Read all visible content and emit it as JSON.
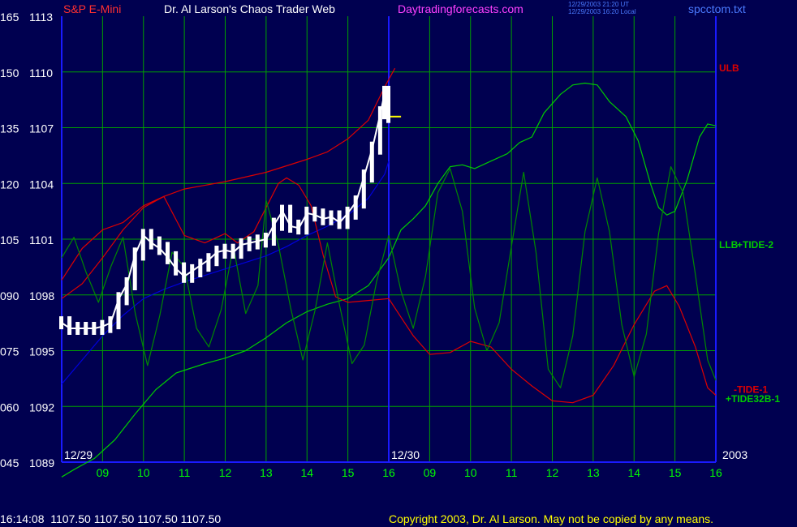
{
  "header": {
    "symbol": "S&P E-Mini",
    "author": "Dr. Al Larson's Chaos Trader Web",
    "site": "Daytradingforecasts.com",
    "stamp_utc": "12/29/2003 21:20 UT",
    "stamp_local": "12/29/2003 16:20 Local",
    "file": "spcctom.txt"
  },
  "footer": {
    "quote": "16:14:08  1107.50 1107.50 1107.50 1107.50",
    "copyright": "Copyright 2003, Dr. Al Larson. May not be copied by any means."
  },
  "colors": {
    "background": "#000050",
    "grid": "#00a000",
    "axis": "#1a1aff",
    "price": "#ffffff",
    "symbol": "#ff3030",
    "author": "#ffffff",
    "site": "#ff40ff",
    "stamp": "#4a7aff",
    "file": "#4a7aff",
    "tick_text": "#ffffff",
    "time_text": "#00ff00",
    "ulb": "#dd0000",
    "llb": "#0000dd",
    "tide2": "#00cc00",
    "tide1": "#dd0000",
    "tide32b": "#008800",
    "forecast": "#ffff00"
  },
  "chart_data": {
    "type": "line",
    "x_unit": "hour (x axis counts hours from 08:00 on 12/29 to 16:00 on 12/30)",
    "xlim": [
      8,
      24
    ],
    "ylim": [
      1089,
      1113
    ],
    "y_ticks": [
      {
        "value": 1113,
        "left": "165",
        "right": "1113"
      },
      {
        "value": 1110,
        "left": "150",
        "right": "1110"
      },
      {
        "value": 1107,
        "left": "135",
        "right": "1107"
      },
      {
        "value": 1104,
        "left": "120",
        "right": "1104"
      },
      {
        "value": 1101,
        "left": "105",
        "right": "1101"
      },
      {
        "value": 1098,
        "left": "090",
        "right": "1098"
      },
      {
        "value": 1095,
        "left": "075",
        "right": "1095"
      },
      {
        "value": 1092,
        "left": "060",
        "right": "1092"
      },
      {
        "value": 1089,
        "left": "045",
        "right": "1089"
      }
    ],
    "x_ticks": [
      {
        "x": 9,
        "label": "09"
      },
      {
        "x": 10,
        "label": "10"
      },
      {
        "x": 11,
        "label": "11"
      },
      {
        "x": 12,
        "label": "12"
      },
      {
        "x": 13,
        "label": "13"
      },
      {
        "x": 14,
        "label": "14"
      },
      {
        "x": 15,
        "label": "15"
      },
      {
        "x": 16,
        "label": "16"
      },
      {
        "x": 17,
        "label": "09"
      },
      {
        "x": 18,
        "label": "10"
      },
      {
        "x": 19,
        "label": "11"
      },
      {
        "x": 20,
        "label": "12"
      },
      {
        "x": 21,
        "label": "13"
      },
      {
        "x": 22,
        "label": "14"
      },
      {
        "x": 23,
        "label": "15"
      },
      {
        "x": 24,
        "label": "16"
      }
    ],
    "day_marks": [
      {
        "x": 8,
        "label": "12/29"
      },
      {
        "x": 16,
        "label": "12/30"
      },
      {
        "x": 24,
        "label": "2003"
      }
    ],
    "grid": true,
    "series": [
      {
        "name": "ULB",
        "role": "band",
        "label_y": 1110.2,
        "points": [
          [
            8,
            1097.8
          ],
          [
            8.5,
            1098.6
          ],
          [
            9,
            1100
          ],
          [
            9.5,
            1101.5
          ],
          [
            10,
            1102.7
          ],
          [
            10.5,
            1103.3
          ],
          [
            11,
            1103.7
          ],
          [
            12,
            1104.1
          ],
          [
            13,
            1104.6
          ],
          [
            14,
            1105.3
          ],
          [
            14.5,
            1105.7
          ],
          [
            15,
            1106.4
          ],
          [
            15.5,
            1107.4
          ],
          [
            15.9,
            1109.2
          ],
          [
            16.15,
            1110.2
          ]
        ]
      },
      {
        "name": "LLB",
        "role": "band",
        "label_y": 1100.7,
        "points": [
          [
            8,
            1093.2
          ],
          [
            8.5,
            1094.5
          ],
          [
            9,
            1095.8
          ],
          [
            9.5,
            1096.9
          ],
          [
            10,
            1097.8
          ],
          [
            10.5,
            1098.3
          ],
          [
            11,
            1098.7
          ],
          [
            12,
            1099.4
          ],
          [
            13,
            1100.1
          ],
          [
            13.5,
            1100.6
          ],
          [
            14,
            1101.2
          ],
          [
            14.5,
            1101.7
          ],
          [
            15,
            1102.3
          ],
          [
            15.5,
            1103.2
          ],
          [
            15.9,
            1104.5
          ],
          [
            16,
            1105.2
          ]
        ]
      },
      {
        "name": "+TIDE-2",
        "role": "tide",
        "label_y": 1100.7,
        "points": [
          [
            8,
            1088.2
          ],
          [
            8.3,
            1088.6
          ],
          [
            8.8,
            1089.2
          ],
          [
            9.3,
            1090.2
          ],
          [
            9.8,
            1091.6
          ],
          [
            10.3,
            1092.9
          ],
          [
            10.8,
            1093.8
          ],
          [
            11.5,
            1094.3
          ],
          [
            12,
            1094.6
          ],
          [
            12.5,
            1095.0
          ],
          [
            13,
            1095.7
          ],
          [
            13.5,
            1096.5
          ],
          [
            14,
            1097.1
          ],
          [
            14.5,
            1097.5
          ],
          [
            15,
            1097.8
          ],
          [
            15.5,
            1098.5
          ],
          [
            15.8,
            1099.4
          ],
          [
            16,
            1100.0
          ],
          [
            16.3,
            1101.5
          ],
          [
            16.6,
            1102.1
          ],
          [
            16.9,
            1102.8
          ],
          [
            17.2,
            1104.0
          ],
          [
            17.5,
            1104.9
          ],
          [
            17.8,
            1105.0
          ],
          [
            18.1,
            1104.8
          ],
          [
            18.5,
            1105.2
          ],
          [
            18.9,
            1105.6
          ],
          [
            19.2,
            1106.2
          ],
          [
            19.5,
            1106.5
          ],
          [
            19.8,
            1107.8
          ],
          [
            20.2,
            1108.8
          ],
          [
            20.5,
            1109.3
          ],
          [
            20.8,
            1109.4
          ],
          [
            21.1,
            1109.3
          ],
          [
            21.4,
            1108.4
          ],
          [
            21.8,
            1107.6
          ],
          [
            22.1,
            1106.3
          ],
          [
            22.4,
            1104.0
          ],
          [
            22.6,
            1102.7
          ],
          [
            22.8,
            1102.3
          ],
          [
            23,
            1102.5
          ],
          [
            23.3,
            1104.2
          ],
          [
            23.6,
            1106.5
          ],
          [
            23.8,
            1107.2
          ],
          [
            24,
            1107.1
          ]
        ]
      },
      {
        "name": "-TIDE-1",
        "role": "tide",
        "label_y": 1092.9,
        "points": [
          [
            8,
            1098.8
          ],
          [
            8.5,
            1100.5
          ],
          [
            9,
            1101.5
          ],
          [
            9.5,
            1101.9
          ],
          [
            10,
            1102.8
          ],
          [
            10.5,
            1103.3
          ],
          [
            11,
            1101.2
          ],
          [
            11.5,
            1100.8
          ],
          [
            12,
            1101.3
          ],
          [
            12.3,
            1100.8
          ],
          [
            12.7,
            1101.4
          ],
          [
            13,
            1102.7
          ],
          [
            13.3,
            1104.0
          ],
          [
            13.5,
            1104.3
          ],
          [
            13.8,
            1103.9
          ],
          [
            14.1,
            1102.8
          ],
          [
            14.4,
            1100.1
          ],
          [
            14.7,
            1097.9
          ],
          [
            15,
            1097.6
          ],
          [
            15.5,
            1097.7
          ],
          [
            16,
            1097.8
          ],
          [
            16.3,
            1096.8
          ],
          [
            16.6,
            1095.8
          ],
          [
            17,
            1094.8
          ],
          [
            17.5,
            1094.9
          ],
          [
            18,
            1095.5
          ],
          [
            18.5,
            1095.2
          ],
          [
            19,
            1094.0
          ],
          [
            19.5,
            1093.1
          ],
          [
            20,
            1092.3
          ],
          [
            20.5,
            1092.2
          ],
          [
            21,
            1092.6
          ],
          [
            21.5,
            1094.2
          ],
          [
            22,
            1096.4
          ],
          [
            22.5,
            1098.2
          ],
          [
            22.8,
            1098.5
          ],
          [
            23.1,
            1097.4
          ],
          [
            23.5,
            1095.2
          ],
          [
            23.8,
            1093.0
          ],
          [
            24,
            1092.6
          ]
        ]
      },
      {
        "name": "+TIDE32B-1",
        "role": "tide",
        "label_y": 1092.4,
        "points": [
          [
            8,
            1100
          ],
          [
            8.3,
            1101.1
          ],
          [
            8.6,
            1099.2
          ],
          [
            8.9,
            1097.6
          ],
          [
            9.2,
            1099.5
          ],
          [
            9.5,
            1101.1
          ],
          [
            9.8,
            1097.0
          ],
          [
            10.1,
            1094.2
          ],
          [
            10.4,
            1096.9
          ],
          [
            10.7,
            1100.3
          ],
          [
            11,
            1099.5
          ],
          [
            11.3,
            1096.2
          ],
          [
            11.6,
            1095.2
          ],
          [
            11.9,
            1097.2
          ],
          [
            12.2,
            1100.6
          ],
          [
            12.5,
            1097.0
          ],
          [
            12.8,
            1098.5
          ],
          [
            13,
            1103.1
          ],
          [
            13.3,
            1100.7
          ],
          [
            13.6,
            1097.3
          ],
          [
            13.9,
            1094.5
          ],
          [
            14.2,
            1097.2
          ],
          [
            14.5,
            1100.8
          ],
          [
            14.8,
            1097.4
          ],
          [
            15.1,
            1094.3
          ],
          [
            15.4,
            1095.3
          ],
          [
            15.7,
            1098.7
          ],
          [
            16,
            1101.2
          ],
          [
            16.3,
            1098.2
          ],
          [
            16.6,
            1096.2
          ],
          [
            16.9,
            1099.0
          ],
          [
            17.2,
            1103.5
          ],
          [
            17.5,
            1104.8
          ],
          [
            17.8,
            1102.5
          ],
          [
            18.1,
            1097.3
          ],
          [
            18.4,
            1095.0
          ],
          [
            18.7,
            1096.5
          ],
          [
            19,
            1100.6
          ],
          [
            19.3,
            1104.6
          ],
          [
            19.6,
            1100.3
          ],
          [
            19.9,
            1094.0
          ],
          [
            20.2,
            1093.0
          ],
          [
            20.5,
            1095.8
          ],
          [
            20.8,
            1101.4
          ],
          [
            21.1,
            1104.3
          ],
          [
            21.4,
            1101.4
          ],
          [
            21.7,
            1096.4
          ],
          [
            22,
            1093.6
          ],
          [
            22.3,
            1095.9
          ],
          [
            22.6,
            1101.3
          ],
          [
            22.9,
            1104.9
          ],
          [
            23.2,
            1103.5
          ],
          [
            23.5,
            1099.1
          ],
          [
            23.8,
            1094.5
          ],
          [
            24,
            1093.4
          ]
        ]
      },
      {
        "name": "forecast",
        "role": "forecast",
        "points": [
          [
            16,
            1107.6
          ],
          [
            16.3,
            1107.6
          ]
        ]
      }
    ],
    "price_points": [
      [
        8,
        1096.5
      ],
      [
        8.2,
        1096.2
      ],
      [
        8.4,
        1096.2
      ],
      [
        8.6,
        1096.2
      ],
      [
        8.8,
        1096.2
      ],
      [
        9,
        1096.3
      ],
      [
        9.2,
        1096.5
      ],
      [
        9.4,
        1097.8
      ],
      [
        9.6,
        1098.6
      ],
      [
        9.8,
        1100.2
      ],
      [
        10,
        1101.2
      ],
      [
        10.2,
        1100.8
      ],
      [
        10.4,
        1100.5
      ],
      [
        10.6,
        1100.0
      ],
      [
        10.8,
        1099.4
      ],
      [
        11,
        1099.0
      ],
      [
        11.2,
        1099.3
      ],
      [
        11.4,
        1099.6
      ],
      [
        11.6,
        1099.9
      ],
      [
        11.8,
        1100.3
      ],
      [
        12,
        1100.4
      ],
      [
        12.2,
        1100.3
      ],
      [
        12.4,
        1100.7
      ],
      [
        12.6,
        1100.8
      ],
      [
        12.8,
        1100.9
      ],
      [
        13,
        1101.0
      ],
      [
        13.2,
        1101.8
      ],
      [
        13.4,
        1102.5
      ],
      [
        13.6,
        1101.7
      ],
      [
        13.8,
        1101.6
      ],
      [
        14,
        1102.4
      ],
      [
        14.2,
        1102.3
      ],
      [
        14.4,
        1102.1
      ],
      [
        14.6,
        1102.2
      ],
      [
        14.8,
        1101.9
      ],
      [
        15,
        1102.4
      ],
      [
        15.2,
        1103.0
      ],
      [
        15.4,
        1104.4
      ],
      [
        15.6,
        1105.9
      ],
      [
        15.8,
        1107.8
      ],
      [
        15.9,
        1108.9
      ],
      [
        16,
        1107.6
      ]
    ]
  }
}
